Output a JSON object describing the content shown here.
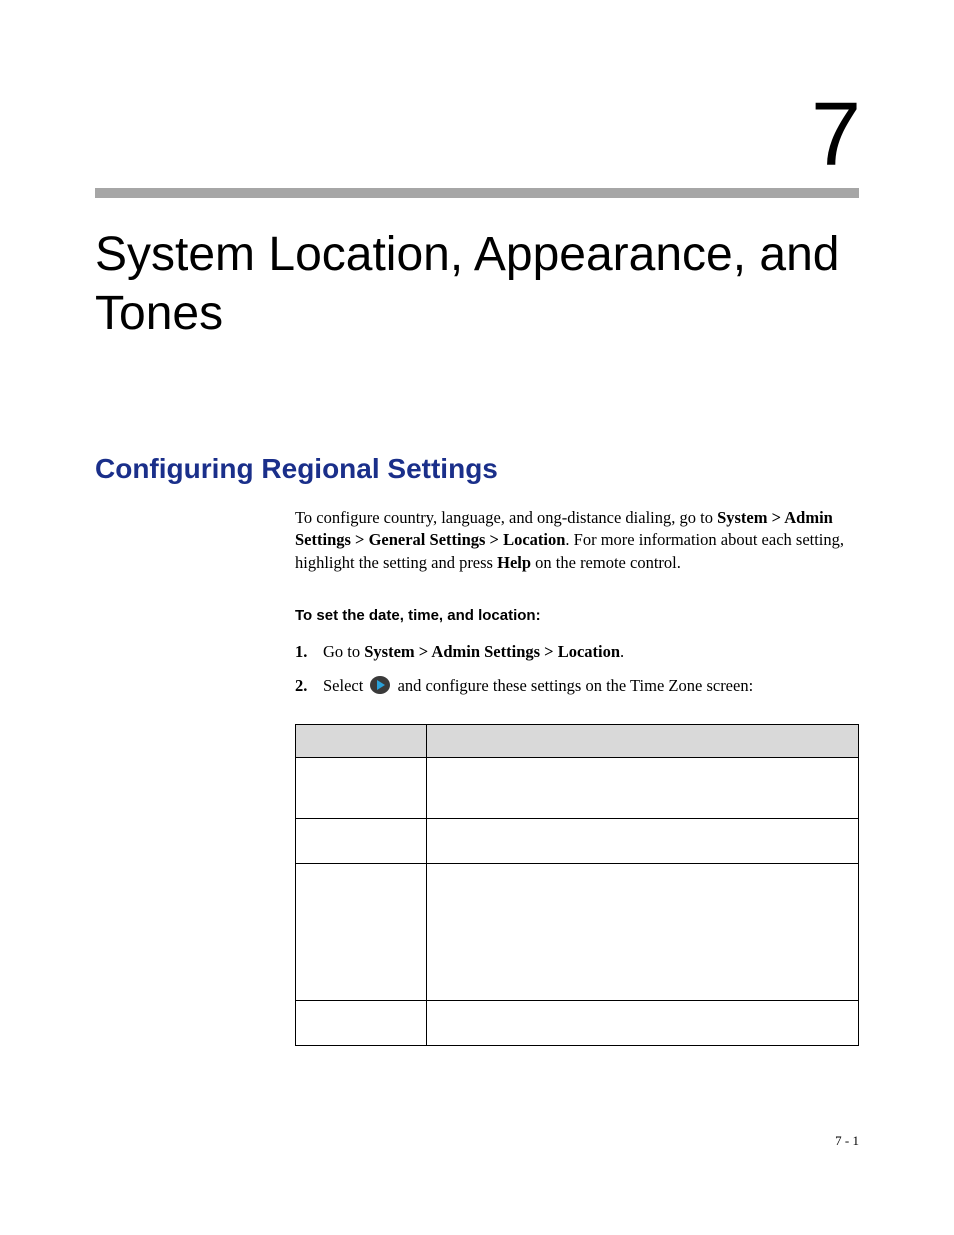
{
  "chapter_number": "7",
  "chapter_title": "System Location, Appearance, and Tones",
  "section_heading": "Configuring Regional Settings",
  "intro": {
    "pre": "To configure country, language, and  ong-distance dialing, go to ",
    "bold1": "System > Admin Settings > General Settings > Location",
    "mid": ". For more information about each setting, highlight the setting and press ",
    "bold2": "Help",
    "post": " on the remote control."
  },
  "procedure_heading": "To set the date, time, and location:",
  "steps": {
    "s1": {
      "pre": "Go to ",
      "bold": "System > Admin Settings > Location",
      "post": "."
    },
    "s2": {
      "pre": "Select ",
      "post": "and configure these settings on the Time Zone screen:"
    }
  },
  "page_footer": "7 - 1"
}
